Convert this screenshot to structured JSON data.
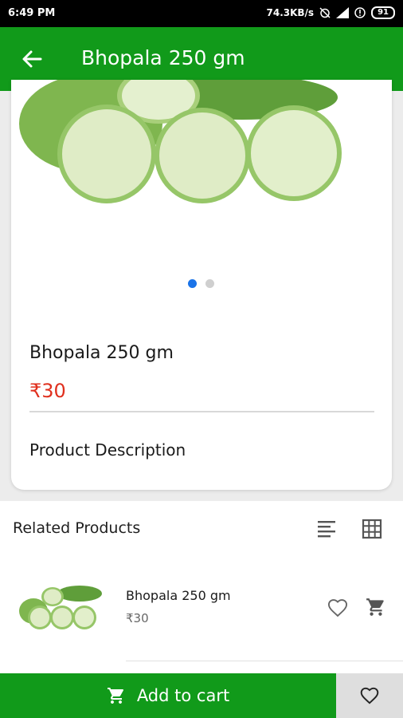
{
  "status_bar": {
    "time": "6:49 PM",
    "network_speed": "74.3KB/s",
    "battery": "91"
  },
  "app_bar": {
    "title": "Bhopala 250 gm",
    "back_icon": "arrow-back-icon"
  },
  "product": {
    "name": "Bhopala 250 gm",
    "price": "₹30",
    "description_title": "Product Description",
    "image_count": 2,
    "active_image_index": 0
  },
  "related": {
    "title": "Related Products",
    "items": [
      {
        "name": "Bhopala 250 gm",
        "price": "₹30"
      }
    ]
  },
  "bottom_bar": {
    "add_to_cart_label": "Add to cart"
  },
  "colors": {
    "primary_green": "#119a1a",
    "price_red": "#e0301e",
    "active_dot": "#1a73e8"
  }
}
